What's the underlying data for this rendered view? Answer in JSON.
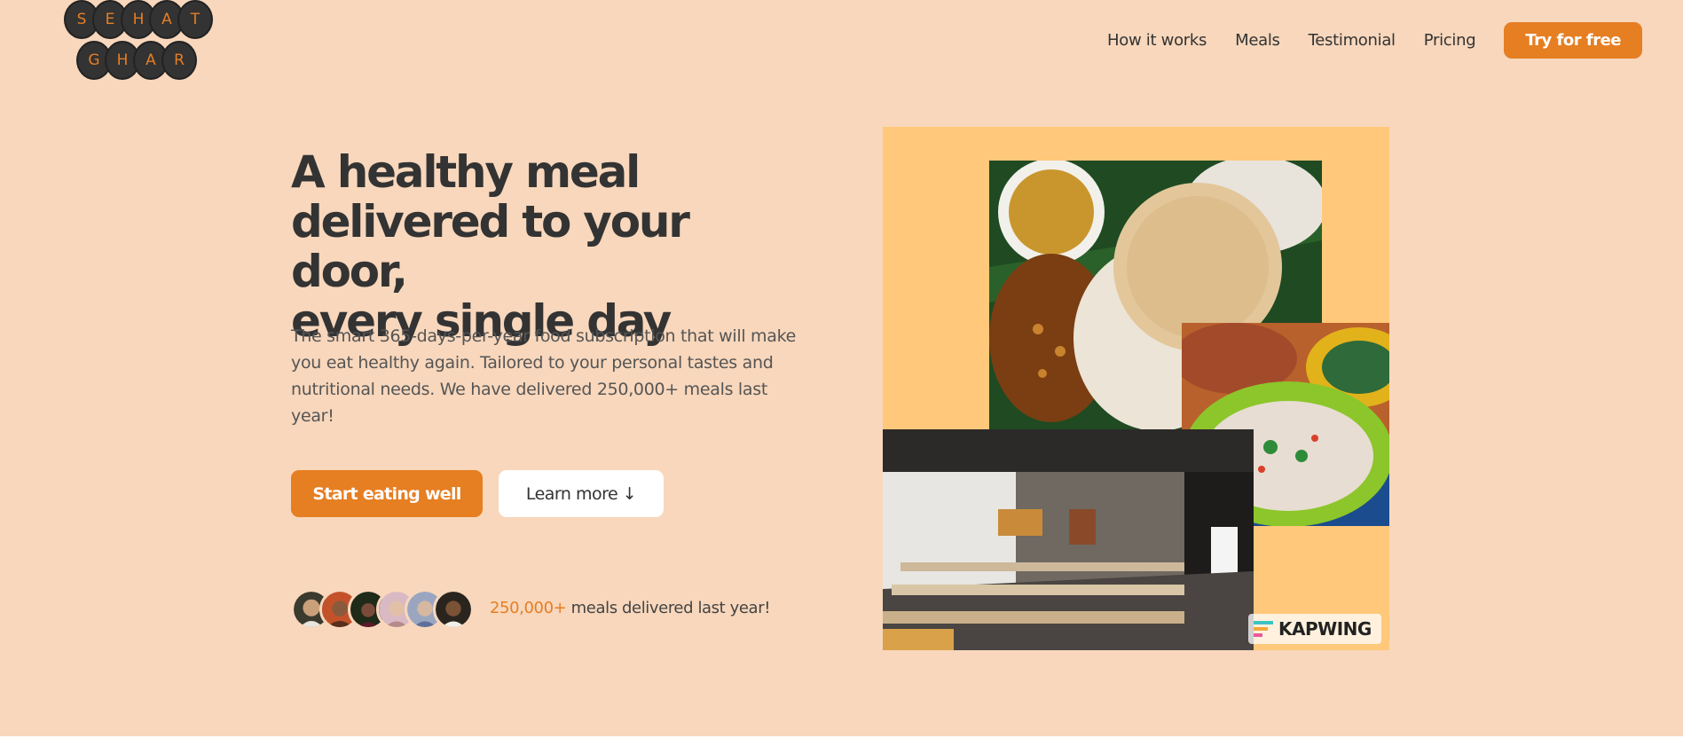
{
  "brand": {
    "logo_row1": [
      "S",
      "E",
      "H",
      "A",
      "T"
    ],
    "logo_row2": [
      "G",
      "H",
      "A",
      "R"
    ],
    "accent_color": "#e67e22",
    "background_color": "#f8d7bc"
  },
  "nav": {
    "items": [
      {
        "label": "How it works"
      },
      {
        "label": "Meals"
      },
      {
        "label": "Testimonial"
      },
      {
        "label": "Pricing"
      }
    ],
    "cta_label": "Try for free"
  },
  "hero": {
    "title_lines": [
      "A healthy meal",
      "delivered to your door,",
      "every single day"
    ],
    "description": "The smart 365-days-per-year food subscription that will make you eat healthy again. Tailored to your personal tastes and nutritional needs. We have delivered 250,000+ meals last year!",
    "primary_cta": "Start eating well",
    "secondary_cta": "Learn more ↓",
    "delivered_count": "250,000+",
    "delivered_text": " meals delivered last year!"
  },
  "customers": {
    "avatar_count": 6
  },
  "collage": {
    "watermark": "KAPWING"
  }
}
